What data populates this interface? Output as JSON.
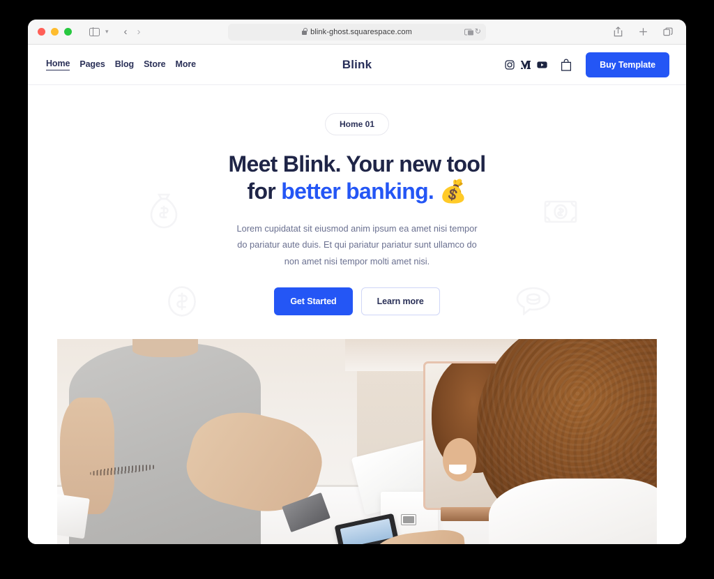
{
  "browser": {
    "url": "blink-ghost.squarespace.com",
    "traffic_lights": [
      "close",
      "minimize",
      "maximize"
    ],
    "left_controls": [
      "sidebar-toggle",
      "sidebar-chevron",
      "back",
      "forward"
    ],
    "address_icons": [
      "lock-icon",
      "reader-icon",
      "reload-icon"
    ],
    "right_controls": [
      "share-icon",
      "new-tab-icon",
      "tabs-icon"
    ],
    "back_arrow": "‹",
    "forward_arrow": "›",
    "reload_glyph": "↻"
  },
  "site": {
    "brand": "Blink",
    "nav": [
      {
        "label": "Home",
        "active": true
      },
      {
        "label": "Pages",
        "active": false
      },
      {
        "label": "Blog",
        "active": false
      },
      {
        "label": "Store",
        "active": false
      },
      {
        "label": "More",
        "active": false
      }
    ],
    "social": [
      "instagram-icon",
      "medium-icon",
      "youtube-icon"
    ],
    "cart_icon": "shopping-bag-icon",
    "buy_button": "Buy Template",
    "hero": {
      "pill": "Home 01",
      "headline_part1": "Meet Blink. Your new tool",
      "headline_part2_prefix": "for ",
      "headline_accent": "better banking.",
      "headline_emoji": "💰",
      "paragraph": "Lorem cupidatat sit eiusmod anim ipsum ea amet nisi tempor do pariatur aute duis. Et qui pariatur pariatur sunt ullamco do non amet nisi tempor molti amet nisi.",
      "primary_cta": "Get Started",
      "secondary_cta": "Learn more",
      "decorations": [
        "money-bag-icon",
        "banknote-icon",
        "dollar-coin-icon",
        "chat-money-icon"
      ],
      "photo_alt": "Man at white point-of-sale terminal and woman with curly hair holding a phone at a counter"
    }
  },
  "colors": {
    "accent_blue": "#2456f5",
    "headline_navy": "#1f2547",
    "body_text": "#6a7090",
    "decoration_gray": "#f4f4f6",
    "page_background": "#000000",
    "chrome_background": "#f6f6f6"
  }
}
